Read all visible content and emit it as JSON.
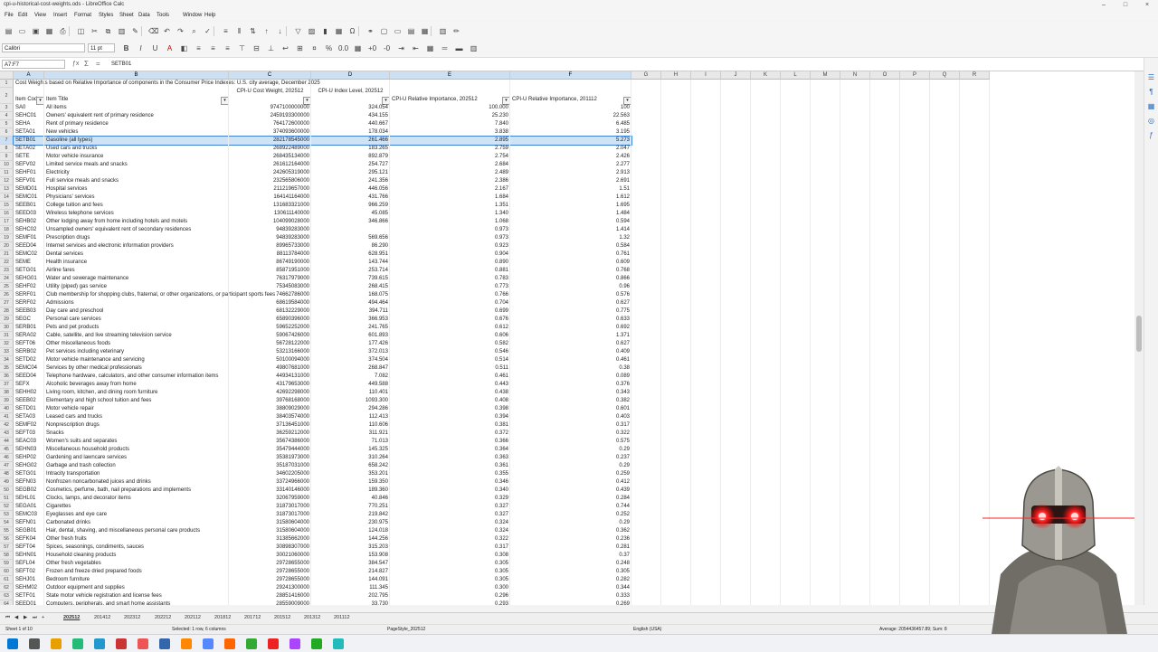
{
  "window": {
    "title": "cpi-u-historical-cost-weights.ods - LibreOffice Calc"
  },
  "menu": [
    "File",
    "Edit",
    "View",
    "Insert",
    "Format",
    "Styles",
    "Sheet",
    "Data",
    "Tools",
    "Window",
    "Help"
  ],
  "toolbar": {
    "font_name": "Calibri",
    "font_size": "11 pt"
  },
  "formula_bar": {
    "name_box": "A7:F7",
    "content": "SETB01"
  },
  "columns": [
    "A",
    "B",
    "C",
    "D",
    "E",
    "F",
    "G",
    "H",
    "I",
    "J",
    "K",
    "L",
    "M",
    "N",
    "O",
    "P",
    "Q",
    "R"
  ],
  "sheet_title": "Cost Weights based on Relative Importance of components in the Consumer Price Indexes: U.S. city average, December 2025",
  "headers": [
    "Item Code",
    "Item Title",
    "CPI-U Cost Weight, 202512",
    "CPI-U Index Level, 202512",
    "CPI-U Relative Importance, 202512",
    "CPI-U Relative Importance, 201112"
  ],
  "rows": [
    [
      "SA0",
      "All items",
      "9747100000000",
      "324.054",
      "100.000",
      "100"
    ],
    [
      "SEHC01",
      "Owners' equivalent rent of primary residence",
      "2459193300000",
      "434.155",
      "25.230",
      "22.563"
    ],
    [
      "SEHA",
      "Rent of primary residence",
      "764172600000",
      "440.667",
      "7.840",
      "6.485"
    ],
    [
      "SETA01",
      "New vehicles",
      "374093600000",
      "178.034",
      "3.838",
      "3.195"
    ],
    [
      "SETB01",
      "Gasoline (all types)",
      "282178545000",
      "261.466",
      "2.895",
      "5.273"
    ],
    [
      "SETA02",
      "Used cars and trucks",
      "268922489000",
      "183.265",
      "2.759",
      "2.047"
    ],
    [
      "SETE",
      "Motor vehicle insurance",
      "268435134000",
      "892.879",
      "2.754",
      "2.426"
    ],
    [
      "SEFV02",
      "Limited service meals and snacks",
      "261612164000",
      "254.727",
      "2.684",
      "2.277"
    ],
    [
      "SEHF01",
      "Electricity",
      "242605319000",
      "295.121",
      "2.489",
      "2.913"
    ],
    [
      "SEFV01",
      "Full service meals and snacks",
      "232565806000",
      "241.356",
      "2.386",
      "2.691"
    ],
    [
      "SEMD01",
      "Hospital services",
      "211219657000",
      "446.056",
      "2.167",
      "1.51"
    ],
    [
      "SEMC01",
      "Physicians' services",
      "164141164000",
      "431.766",
      "1.684",
      "1.612"
    ],
    [
      "SEEB01",
      "College tuition and fees",
      "131683321000",
      "966.259",
      "1.351",
      "1.695"
    ],
    [
      "SEED03",
      "Wireless telephone services",
      "130611140000",
      "45.085",
      "1.340",
      "1.484"
    ],
    [
      "SEHB02",
      "Other lodging away from home including hotels and motels",
      "104099028000",
      "346.866",
      "1.068",
      "0.594"
    ],
    [
      "SEHC02",
      "Unsampled owners' equivalent rent of secondary residences",
      "94839283000",
      "",
      "0.973",
      "1.414"
    ],
    [
      "SEMF01",
      "Prescription drugs",
      "94839283000",
      "569.656",
      "0.973",
      "1.32"
    ],
    [
      "SEED04",
      "Internet services and electronic information providers",
      "89965733000",
      "86.290",
      "0.923",
      "0.584"
    ],
    [
      "SEMC02",
      "Dental services",
      "88113784000",
      "628.951",
      "0.904",
      "0.761"
    ],
    [
      "SEME",
      "Health insurance",
      "86749190000",
      "143.744",
      "0.890",
      "0.609"
    ],
    [
      "SETG01",
      "Airline fares",
      "85871951000",
      "253.714",
      "0.881",
      "0.768"
    ],
    [
      "SEHG01",
      "Water and sewerage maintenance",
      "76317979000",
      "739.615",
      "0.783",
      "0.866"
    ],
    [
      "SEHF02",
      "Utility (piped) gas service",
      "75345083000",
      "268.415",
      "0.773",
      "0.96"
    ],
    [
      "SERF01",
      "Club membership for shopping clubs, fraternal, or other organizations, or participant sports fees",
      "74662786000",
      "168.075",
      "0.766",
      "0.576"
    ],
    [
      "SERF02",
      "Admissions",
      "68619584000",
      "494.464",
      "0.704",
      "0.627"
    ],
    [
      "SEEB03",
      "Day care and preschool",
      "68132229000",
      "394.711",
      "0.699",
      "0.775"
    ],
    [
      "SEGC",
      "Personal care services",
      "65890396000",
      "366.953",
      "0.676",
      "0.633"
    ],
    [
      "SERB01",
      "Pets and pet products",
      "59652252000",
      "241.765",
      "0.612",
      "0.692"
    ],
    [
      "SERA02",
      "Cable, satellite, and live streaming television service",
      "59067426000",
      "601.893",
      "0.606",
      "1.371"
    ],
    [
      "SEFT06",
      "Other miscellaneous foods",
      "56728122000",
      "177.426",
      "0.582",
      "0.627"
    ],
    [
      "SERB02",
      "Pet services including veterinary",
      "53213166000",
      "372.013",
      "0.546",
      "0.409"
    ],
    [
      "SETD02",
      "Motor vehicle maintenance and servicing",
      "50100094000",
      "374.504",
      "0.514",
      "0.461"
    ],
    [
      "SEMC04",
      "Services by other medical professionals",
      "49807681000",
      "268.847",
      "0.511",
      "0.38"
    ],
    [
      "SEED04",
      "Telephone hardware, calculators, and other consumer information items",
      "44934131000",
      "7.082",
      "0.461",
      "0.089"
    ],
    [
      "SEFX",
      "Alcoholic beverages away from home",
      "43179653000",
      "449.588",
      "0.443",
      "0.376"
    ],
    [
      "SEHH02",
      "Living room, kitchen, and dining room furniture",
      "42692298000",
      "110.401",
      "0.438",
      "0.343"
    ],
    [
      "SEEB02",
      "Elementary and high school tuition and fees",
      "39768168000",
      "1093.300",
      "0.408",
      "0.382"
    ],
    [
      "SETD01",
      "Motor vehicle repair",
      "38809029000",
      "294.286",
      "0.398",
      "0.601"
    ],
    [
      "SETA03",
      "Leased cars and trucks",
      "38403574000",
      "112.413",
      "0.394",
      "0.403"
    ],
    [
      "SEMF02",
      "Nonprescription drugs",
      "37136451000",
      "110.606",
      "0.381",
      "0.317"
    ],
    [
      "SEFT03",
      "Snacks",
      "36259212000",
      "311.921",
      "0.372",
      "0.322"
    ],
    [
      "SEAC03",
      "Women's suits and separates",
      "35674386000",
      "71.013",
      "0.366",
      "0.575"
    ],
    [
      "SEHN03",
      "Miscellaneous household products",
      "35479444000",
      "145.325",
      "0.364",
      "0.29"
    ],
    [
      "SEHP02",
      "Gardening and lawncare services",
      "35381973000",
      "310.264",
      "0.363",
      "0.237"
    ],
    [
      "SEHG02",
      "Garbage and trash collection",
      "35187031000",
      "658.242",
      "0.361",
      "0.29"
    ],
    [
      "SETG01",
      "Intracity transportation",
      "34602205000",
      "353.201",
      "0.355",
      "0.259"
    ],
    [
      "SEFN03",
      "Nonfrozen noncarbonated juices and drinks",
      "33724966000",
      "159.350",
      "0.346",
      "0.412"
    ],
    [
      "SEGB02",
      "Cosmetics, perfume, bath, nail preparations and implements",
      "33140146000",
      "189.360",
      "0.340",
      "0.439"
    ],
    [
      "SEHL01",
      "Clocks, lamps, and decorator items",
      "32067959000",
      "40.846",
      "0.329",
      "0.284"
    ],
    [
      "SEGA01",
      "Cigarettes",
      "31873017000",
      "770.251",
      "0.327",
      "0.744"
    ],
    [
      "SEMC03",
      "Eyeglasses and eye care",
      "31873017000",
      "219.842",
      "0.327",
      "0.252"
    ],
    [
      "SEFN01",
      "Carbonated drinks",
      "31580604000",
      "230.975",
      "0.324",
      "0.29"
    ],
    [
      "SEGB01",
      "Hair, dental, shaving, and miscellaneous personal care products",
      "31580604000",
      "124.018",
      "0.324",
      "0.362"
    ],
    [
      "SEFK04",
      "Other fresh fruits",
      "31385662000",
      "144.256",
      "0.322",
      "0.236"
    ],
    [
      "SEFT04",
      "Spices, seasonings, condiments, sauces",
      "30898307000",
      "315.203",
      "0.317",
      "0.281"
    ],
    [
      "SEHN01",
      "Household cleaning products",
      "30021060000",
      "153.908",
      "0.308",
      "0.37"
    ],
    [
      "SEFL04",
      "Other fresh vegetables",
      "29728655000",
      "384.547",
      "0.305",
      "0.248"
    ],
    [
      "SEFT02",
      "Frozen and freeze dried prepared foods",
      "29728655000",
      "214.827",
      "0.305",
      "0.305"
    ],
    [
      "SEHJ01",
      "Bedroom furniture",
      "29728655000",
      "144.091",
      "0.305",
      "0.282"
    ],
    [
      "SEHM02",
      "Outdoor equipment and supplies",
      "29241300000",
      "111.345",
      "0.300",
      "0.344"
    ],
    [
      "SETF01",
      "State motor vehicle registration and license fees",
      "28851416000",
      "202.795",
      "0.296",
      "0.333"
    ],
    [
      "SEED01",
      "Computers, peripherals, and smart home assistants",
      "28559009000",
      "33.730",
      "0.293",
      "0.269"
    ]
  ],
  "sheet_tabs": [
    "202512",
    "201412",
    "202312",
    "202212",
    "202112",
    "201812",
    "201712",
    "201512",
    "201312",
    "201112"
  ],
  "status": {
    "sheet": "Sheet 1 of 10",
    "selection": "Selected: 1 row, 6 columns",
    "page_style": "PageStyle_202512",
    "language": "English (USA)",
    "summary": "Average: 2054436457.89; Sum: 8"
  }
}
